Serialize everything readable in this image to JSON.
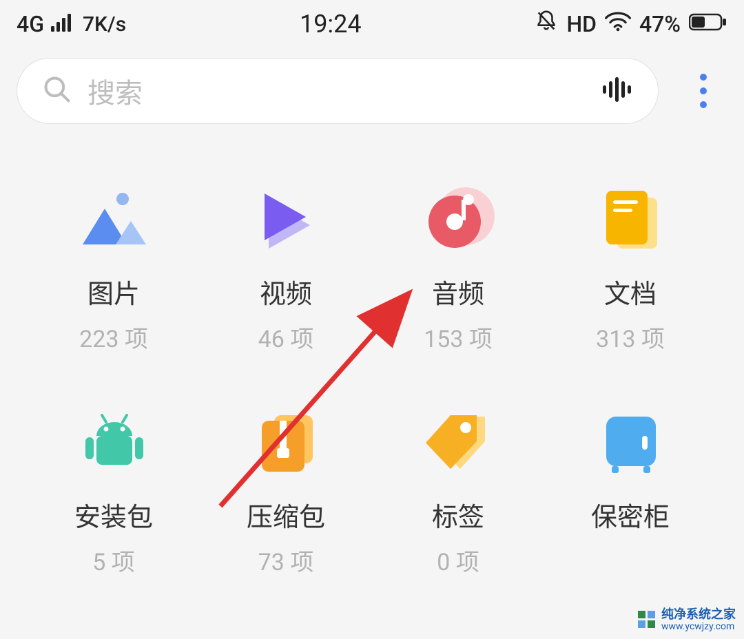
{
  "status": {
    "network_type": "4G",
    "net_speed": "7K/s",
    "time": "19:24",
    "hd": "HD",
    "battery_pct": "47%"
  },
  "search": {
    "placeholder": "搜索"
  },
  "categories": [
    {
      "label": "图片",
      "count": "223 项"
    },
    {
      "label": "视频",
      "count": "46 项"
    },
    {
      "label": "音频",
      "count": "153 项"
    },
    {
      "label": "文档",
      "count": "313 项"
    },
    {
      "label": "安装包",
      "count": "5 项"
    },
    {
      "label": "压缩包",
      "count": "73 项"
    },
    {
      "label": "标签",
      "count": "0 项"
    },
    {
      "label": "保密柜",
      "count": ""
    }
  ],
  "watermark": {
    "title": "纯净系统之家",
    "url": "www.ycwjzy.com"
  }
}
